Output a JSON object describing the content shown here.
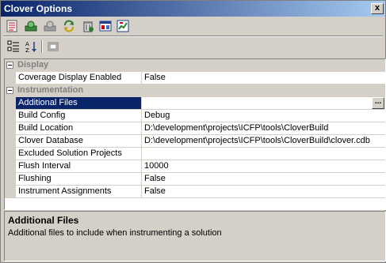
{
  "window": {
    "title": "Clover Options",
    "close_label": "x"
  },
  "toolbar": {
    "buttons": [
      {
        "name": "report-icon"
      },
      {
        "name": "enable-icon"
      },
      {
        "name": "disable-icon"
      },
      {
        "name": "refresh-icon"
      },
      {
        "name": "delete-icon"
      },
      {
        "name": "view-icon"
      },
      {
        "name": "chart-icon"
      }
    ]
  },
  "grid_toolbar": {
    "buttons": [
      {
        "name": "categorized-icon"
      },
      {
        "name": "alphabetical-icon"
      },
      {
        "name": "property-pages-icon"
      }
    ]
  },
  "grid": {
    "categories": [
      {
        "label": "Display",
        "properties": [
          {
            "name": "Coverage Display Enabled",
            "value": "False"
          }
        ]
      },
      {
        "label": "Instrumentation",
        "properties": [
          {
            "name": "Additional Files",
            "value": "",
            "selected": true,
            "button": "..."
          },
          {
            "name": "Build Config",
            "value": "Debug"
          },
          {
            "name": "Build Location",
            "value": "D:\\development\\projects\\ICFP\\tools\\CloverBuild"
          },
          {
            "name": "Clover Database",
            "value": "D:\\development\\projects\\ICFP\\tools\\CloverBuild\\clover.cdb"
          },
          {
            "name": "Excluded Solution Projects",
            "value": ""
          },
          {
            "name": "Flush Interval",
            "value": "10000"
          },
          {
            "name": "Flushing",
            "value": "False"
          },
          {
            "name": "Instrument Assignments",
            "value": "False"
          }
        ]
      }
    ]
  },
  "description": {
    "title": "Additional Files",
    "text": "Additional files to include when instrumenting a solution"
  },
  "colors": {
    "selection": "#0a246a",
    "face": "#d4d0c8",
    "title_start": "#0a246a",
    "title_end": "#a6caf0"
  }
}
